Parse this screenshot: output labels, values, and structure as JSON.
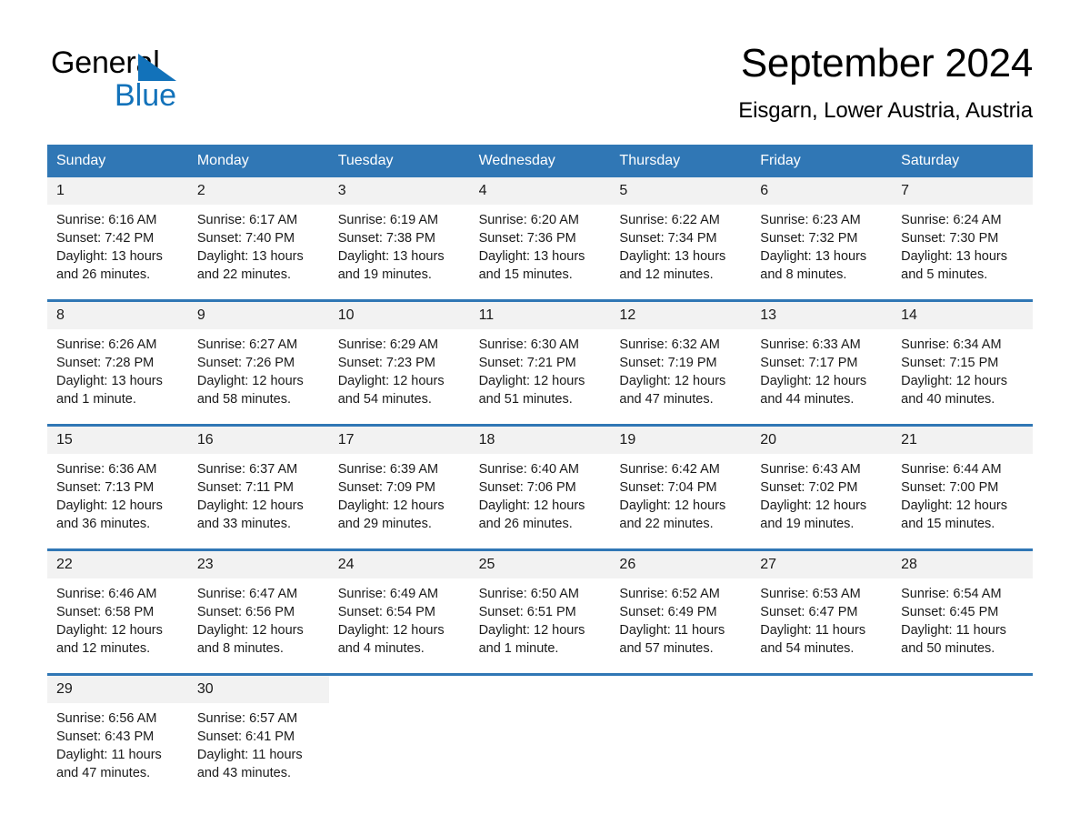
{
  "brand": {
    "name_part1": "General",
    "name_part2": "Blue",
    "accent_color": "#1272ba"
  },
  "header": {
    "title": "September 2024",
    "subtitle": "Eisgarn, Lower Austria, Austria"
  },
  "theme": {
    "header_blue": "#3077b5",
    "day_band_gray": "#f2f2f2",
    "text_color": "#1a1a1a"
  },
  "calendar": {
    "weekday_headers": [
      "Sunday",
      "Monday",
      "Tuesday",
      "Wednesday",
      "Thursday",
      "Friday",
      "Saturday"
    ],
    "labels": {
      "sunrise": "Sunrise:",
      "sunset": "Sunset:",
      "daylight": "Daylight:"
    },
    "weeks": [
      [
        {
          "day": "1",
          "sunrise": "Sunrise: 6:16 AM",
          "sunset": "Sunset: 7:42 PM",
          "daylight": "Daylight: 13 hours and 26 minutes."
        },
        {
          "day": "2",
          "sunrise": "Sunrise: 6:17 AM",
          "sunset": "Sunset: 7:40 PM",
          "daylight": "Daylight: 13 hours and 22 minutes."
        },
        {
          "day": "3",
          "sunrise": "Sunrise: 6:19 AM",
          "sunset": "Sunset: 7:38 PM",
          "daylight": "Daylight: 13 hours and 19 minutes."
        },
        {
          "day": "4",
          "sunrise": "Sunrise: 6:20 AM",
          "sunset": "Sunset: 7:36 PM",
          "daylight": "Daylight: 13 hours and 15 minutes."
        },
        {
          "day": "5",
          "sunrise": "Sunrise: 6:22 AM",
          "sunset": "Sunset: 7:34 PM",
          "daylight": "Daylight: 13 hours and 12 minutes."
        },
        {
          "day": "6",
          "sunrise": "Sunrise: 6:23 AM",
          "sunset": "Sunset: 7:32 PM",
          "daylight": "Daylight: 13 hours and 8 minutes."
        },
        {
          "day": "7",
          "sunrise": "Sunrise: 6:24 AM",
          "sunset": "Sunset: 7:30 PM",
          "daylight": "Daylight: 13 hours and 5 minutes."
        }
      ],
      [
        {
          "day": "8",
          "sunrise": "Sunrise: 6:26 AM",
          "sunset": "Sunset: 7:28 PM",
          "daylight": "Daylight: 13 hours and 1 minute."
        },
        {
          "day": "9",
          "sunrise": "Sunrise: 6:27 AM",
          "sunset": "Sunset: 7:26 PM",
          "daylight": "Daylight: 12 hours and 58 minutes."
        },
        {
          "day": "10",
          "sunrise": "Sunrise: 6:29 AM",
          "sunset": "Sunset: 7:23 PM",
          "daylight": "Daylight: 12 hours and 54 minutes."
        },
        {
          "day": "11",
          "sunrise": "Sunrise: 6:30 AM",
          "sunset": "Sunset: 7:21 PM",
          "daylight": "Daylight: 12 hours and 51 minutes."
        },
        {
          "day": "12",
          "sunrise": "Sunrise: 6:32 AM",
          "sunset": "Sunset: 7:19 PM",
          "daylight": "Daylight: 12 hours and 47 minutes."
        },
        {
          "day": "13",
          "sunrise": "Sunrise: 6:33 AM",
          "sunset": "Sunset: 7:17 PM",
          "daylight": "Daylight: 12 hours and 44 minutes."
        },
        {
          "day": "14",
          "sunrise": "Sunrise: 6:34 AM",
          "sunset": "Sunset: 7:15 PM",
          "daylight": "Daylight: 12 hours and 40 minutes."
        }
      ],
      [
        {
          "day": "15",
          "sunrise": "Sunrise: 6:36 AM",
          "sunset": "Sunset: 7:13 PM",
          "daylight": "Daylight: 12 hours and 36 minutes."
        },
        {
          "day": "16",
          "sunrise": "Sunrise: 6:37 AM",
          "sunset": "Sunset: 7:11 PM",
          "daylight": "Daylight: 12 hours and 33 minutes."
        },
        {
          "day": "17",
          "sunrise": "Sunrise: 6:39 AM",
          "sunset": "Sunset: 7:09 PM",
          "daylight": "Daylight: 12 hours and 29 minutes."
        },
        {
          "day": "18",
          "sunrise": "Sunrise: 6:40 AM",
          "sunset": "Sunset: 7:06 PM",
          "daylight": "Daylight: 12 hours and 26 minutes."
        },
        {
          "day": "19",
          "sunrise": "Sunrise: 6:42 AM",
          "sunset": "Sunset: 7:04 PM",
          "daylight": "Daylight: 12 hours and 22 minutes."
        },
        {
          "day": "20",
          "sunrise": "Sunrise: 6:43 AM",
          "sunset": "Sunset: 7:02 PM",
          "daylight": "Daylight: 12 hours and 19 minutes."
        },
        {
          "day": "21",
          "sunrise": "Sunrise: 6:44 AM",
          "sunset": "Sunset: 7:00 PM",
          "daylight": "Daylight: 12 hours and 15 minutes."
        }
      ],
      [
        {
          "day": "22",
          "sunrise": "Sunrise: 6:46 AM",
          "sunset": "Sunset: 6:58 PM",
          "daylight": "Daylight: 12 hours and 12 minutes."
        },
        {
          "day": "23",
          "sunrise": "Sunrise: 6:47 AM",
          "sunset": "Sunset: 6:56 PM",
          "daylight": "Daylight: 12 hours and 8 minutes."
        },
        {
          "day": "24",
          "sunrise": "Sunrise: 6:49 AM",
          "sunset": "Sunset: 6:54 PM",
          "daylight": "Daylight: 12 hours and 4 minutes."
        },
        {
          "day": "25",
          "sunrise": "Sunrise: 6:50 AM",
          "sunset": "Sunset: 6:51 PM",
          "daylight": "Daylight: 12 hours and 1 minute."
        },
        {
          "day": "26",
          "sunrise": "Sunrise: 6:52 AM",
          "sunset": "Sunset: 6:49 PM",
          "daylight": "Daylight: 11 hours and 57 minutes."
        },
        {
          "day": "27",
          "sunrise": "Sunrise: 6:53 AM",
          "sunset": "Sunset: 6:47 PM",
          "daylight": "Daylight: 11 hours and 54 minutes."
        },
        {
          "day": "28",
          "sunrise": "Sunrise: 6:54 AM",
          "sunset": "Sunset: 6:45 PM",
          "daylight": "Daylight: 11 hours and 50 minutes."
        }
      ],
      [
        {
          "day": "29",
          "sunrise": "Sunrise: 6:56 AM",
          "sunset": "Sunset: 6:43 PM",
          "daylight": "Daylight: 11 hours and 47 minutes."
        },
        {
          "day": "30",
          "sunrise": "Sunrise: 6:57 AM",
          "sunset": "Sunset: 6:41 PM",
          "daylight": "Daylight: 11 hours and 43 minutes."
        },
        {
          "day": "",
          "sunrise": "",
          "sunset": "",
          "daylight": ""
        },
        {
          "day": "",
          "sunrise": "",
          "sunset": "",
          "daylight": ""
        },
        {
          "day": "",
          "sunrise": "",
          "sunset": "",
          "daylight": ""
        },
        {
          "day": "",
          "sunrise": "",
          "sunset": "",
          "daylight": ""
        },
        {
          "day": "",
          "sunrise": "",
          "sunset": "",
          "daylight": ""
        }
      ]
    ]
  }
}
